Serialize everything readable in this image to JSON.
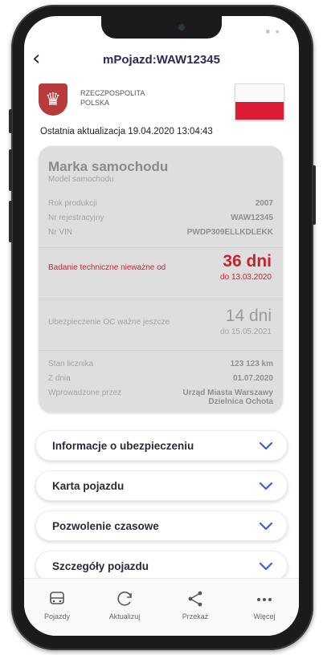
{
  "header": {
    "title": "mPojazd:WAW12345"
  },
  "republic": {
    "line1": "RZECZPOSPOLITA",
    "line2": "POLSKA"
  },
  "updated": "Ostatnia aktualizacja 19.04.2020 13:04:43",
  "card": {
    "brand": "Marka samochodu",
    "model": "Model samochodu",
    "rows": [
      {
        "label": "Rok produkcji",
        "value": "2007"
      },
      {
        "label": "Nr rejestracyjny",
        "value": "WAW12345"
      },
      {
        "label": "Nr VIN",
        "value": "PWDP309ELLKDLEKK"
      }
    ],
    "inspection": {
      "label": "Badanie techniczne nieważne od",
      "value": "36 dni",
      "date": "do 13.03.2020"
    },
    "insurance": {
      "label": "Ubezpieczenie OC ważne jeszcze",
      "value": "14 dni",
      "date": "do 15.05.2021"
    },
    "odometer": {
      "label": "Stan licznika",
      "value": "123 123 km"
    },
    "date": {
      "label": "Z dnia",
      "value": "01.07.2020"
    },
    "entered": {
      "label": "Wprowadzone przez",
      "value1": "Urząd Miasta Warszawy",
      "value2": "Dzielnica Ochota"
    }
  },
  "accordions": [
    {
      "label": "Informacje o ubezpieczeniu"
    },
    {
      "label": "Karta pojazdu"
    },
    {
      "label": "Pozwolenie czasowe"
    },
    {
      "label": "Szczegóły pojazdu"
    }
  ],
  "tabs": [
    {
      "label": "Pojazdy",
      "icon": "car-icon"
    },
    {
      "label": "Aktualizuj",
      "icon": "refresh-icon"
    },
    {
      "label": "Przekaż",
      "icon": "share-icon"
    },
    {
      "label": "Więcej",
      "icon": "more-icon"
    }
  ],
  "colors": {
    "accent": "#2b2a54",
    "alert": "#c6242f",
    "flag_red": "#dc1c34",
    "chevron": "#3f5fd6"
  }
}
